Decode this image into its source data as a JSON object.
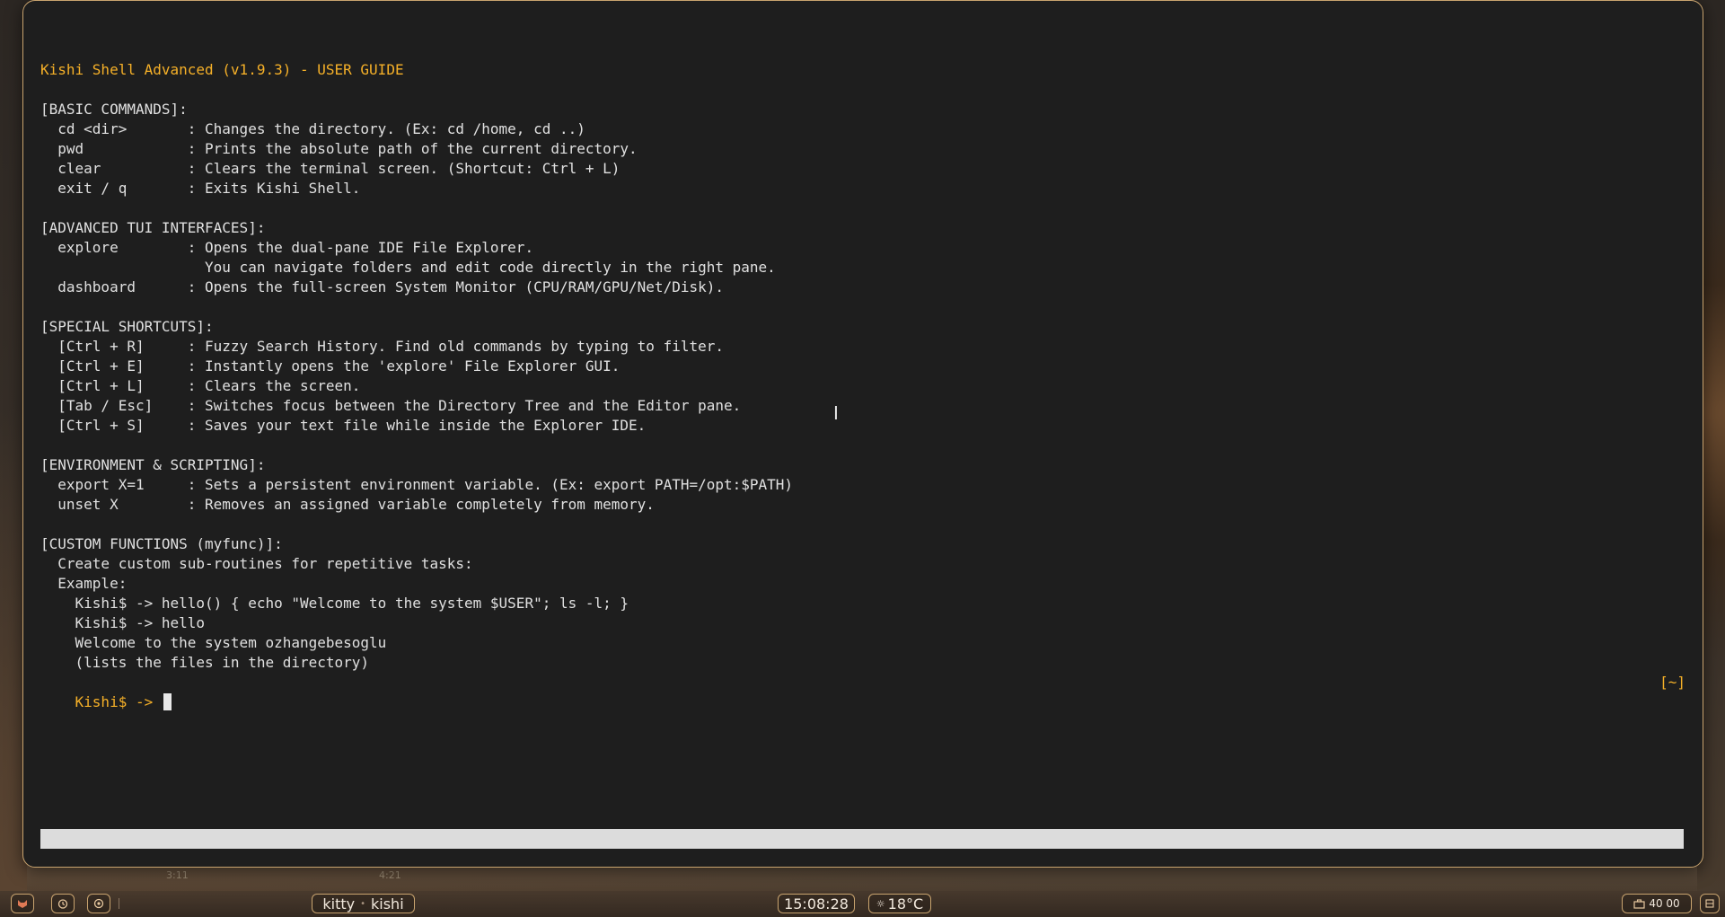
{
  "terminal": {
    "lines": [
      "",
      "Kishi Shell Advanced (v1.9.3) - USER GUIDE",
      "",
      "[BASIC COMMANDS]:",
      "  cd <dir>       : Changes the directory. (Ex: cd /home, cd ..)",
      "  pwd            : Prints the absolute path of the current directory.",
      "  clear          : Clears the terminal screen. (Shortcut: Ctrl + L)",
      "  exit / q       : Exits Kishi Shell.",
      "",
      "[ADVANCED TUI INTERFACES]:",
      "  explore        : Opens the dual-pane IDE File Explorer.",
      "                   You can navigate folders and edit code directly in the right pane.",
      "  dashboard      : Opens the full-screen System Monitor (CPU/RAM/GPU/Net/Disk).",
      "",
      "[SPECIAL SHORTCUTS]:",
      "  [Ctrl + R]     : Fuzzy Search History. Find old commands by typing to filter.",
      "  [Ctrl + E]     : Instantly opens the 'explore' File Explorer GUI.",
      "  [Ctrl + L]     : Clears the screen.",
      "  [Tab / Esc]    : Switches focus between the Directory Tree and the Editor pane.",
      "  [Ctrl + S]     : Saves your text file while inside the Explorer IDE.",
      "",
      "[ENVIRONMENT & SCRIPTING]:",
      "  export X=1     : Sets a persistent environment variable. (Ex: export PATH=/opt:$PATH)",
      "  unset X        : Removes an assigned variable completely from memory.",
      "",
      "[CUSTOM FUNCTIONS (myfunc)]:",
      "  Create custom sub-routines for repetitive tasks:",
      "  Example:",
      "    Kishi$ -> hello() { echo \"Welcome to the system $USER\"; ls -l; }",
      "    Kishi$ -> hello",
      "    Welcome to the system ozhangebesoglu",
      "    (lists the files in the directory)"
    ],
    "prompt": "Kishi$ -> ",
    "cwd": "[~]"
  },
  "wallpaper": {
    "time_left": "3:11",
    "time_right": "4:21"
  },
  "taskbar": {
    "window_app": "kitty",
    "window_title": "kishi",
    "clock": "15:08:28",
    "weather": "18°C",
    "tray_label": "40 00"
  },
  "colors": {
    "accent": "#f5b028",
    "terminal_bg": "#1e1e1e",
    "terminal_fg": "#e0e0e0",
    "border": "#c9a46f"
  }
}
